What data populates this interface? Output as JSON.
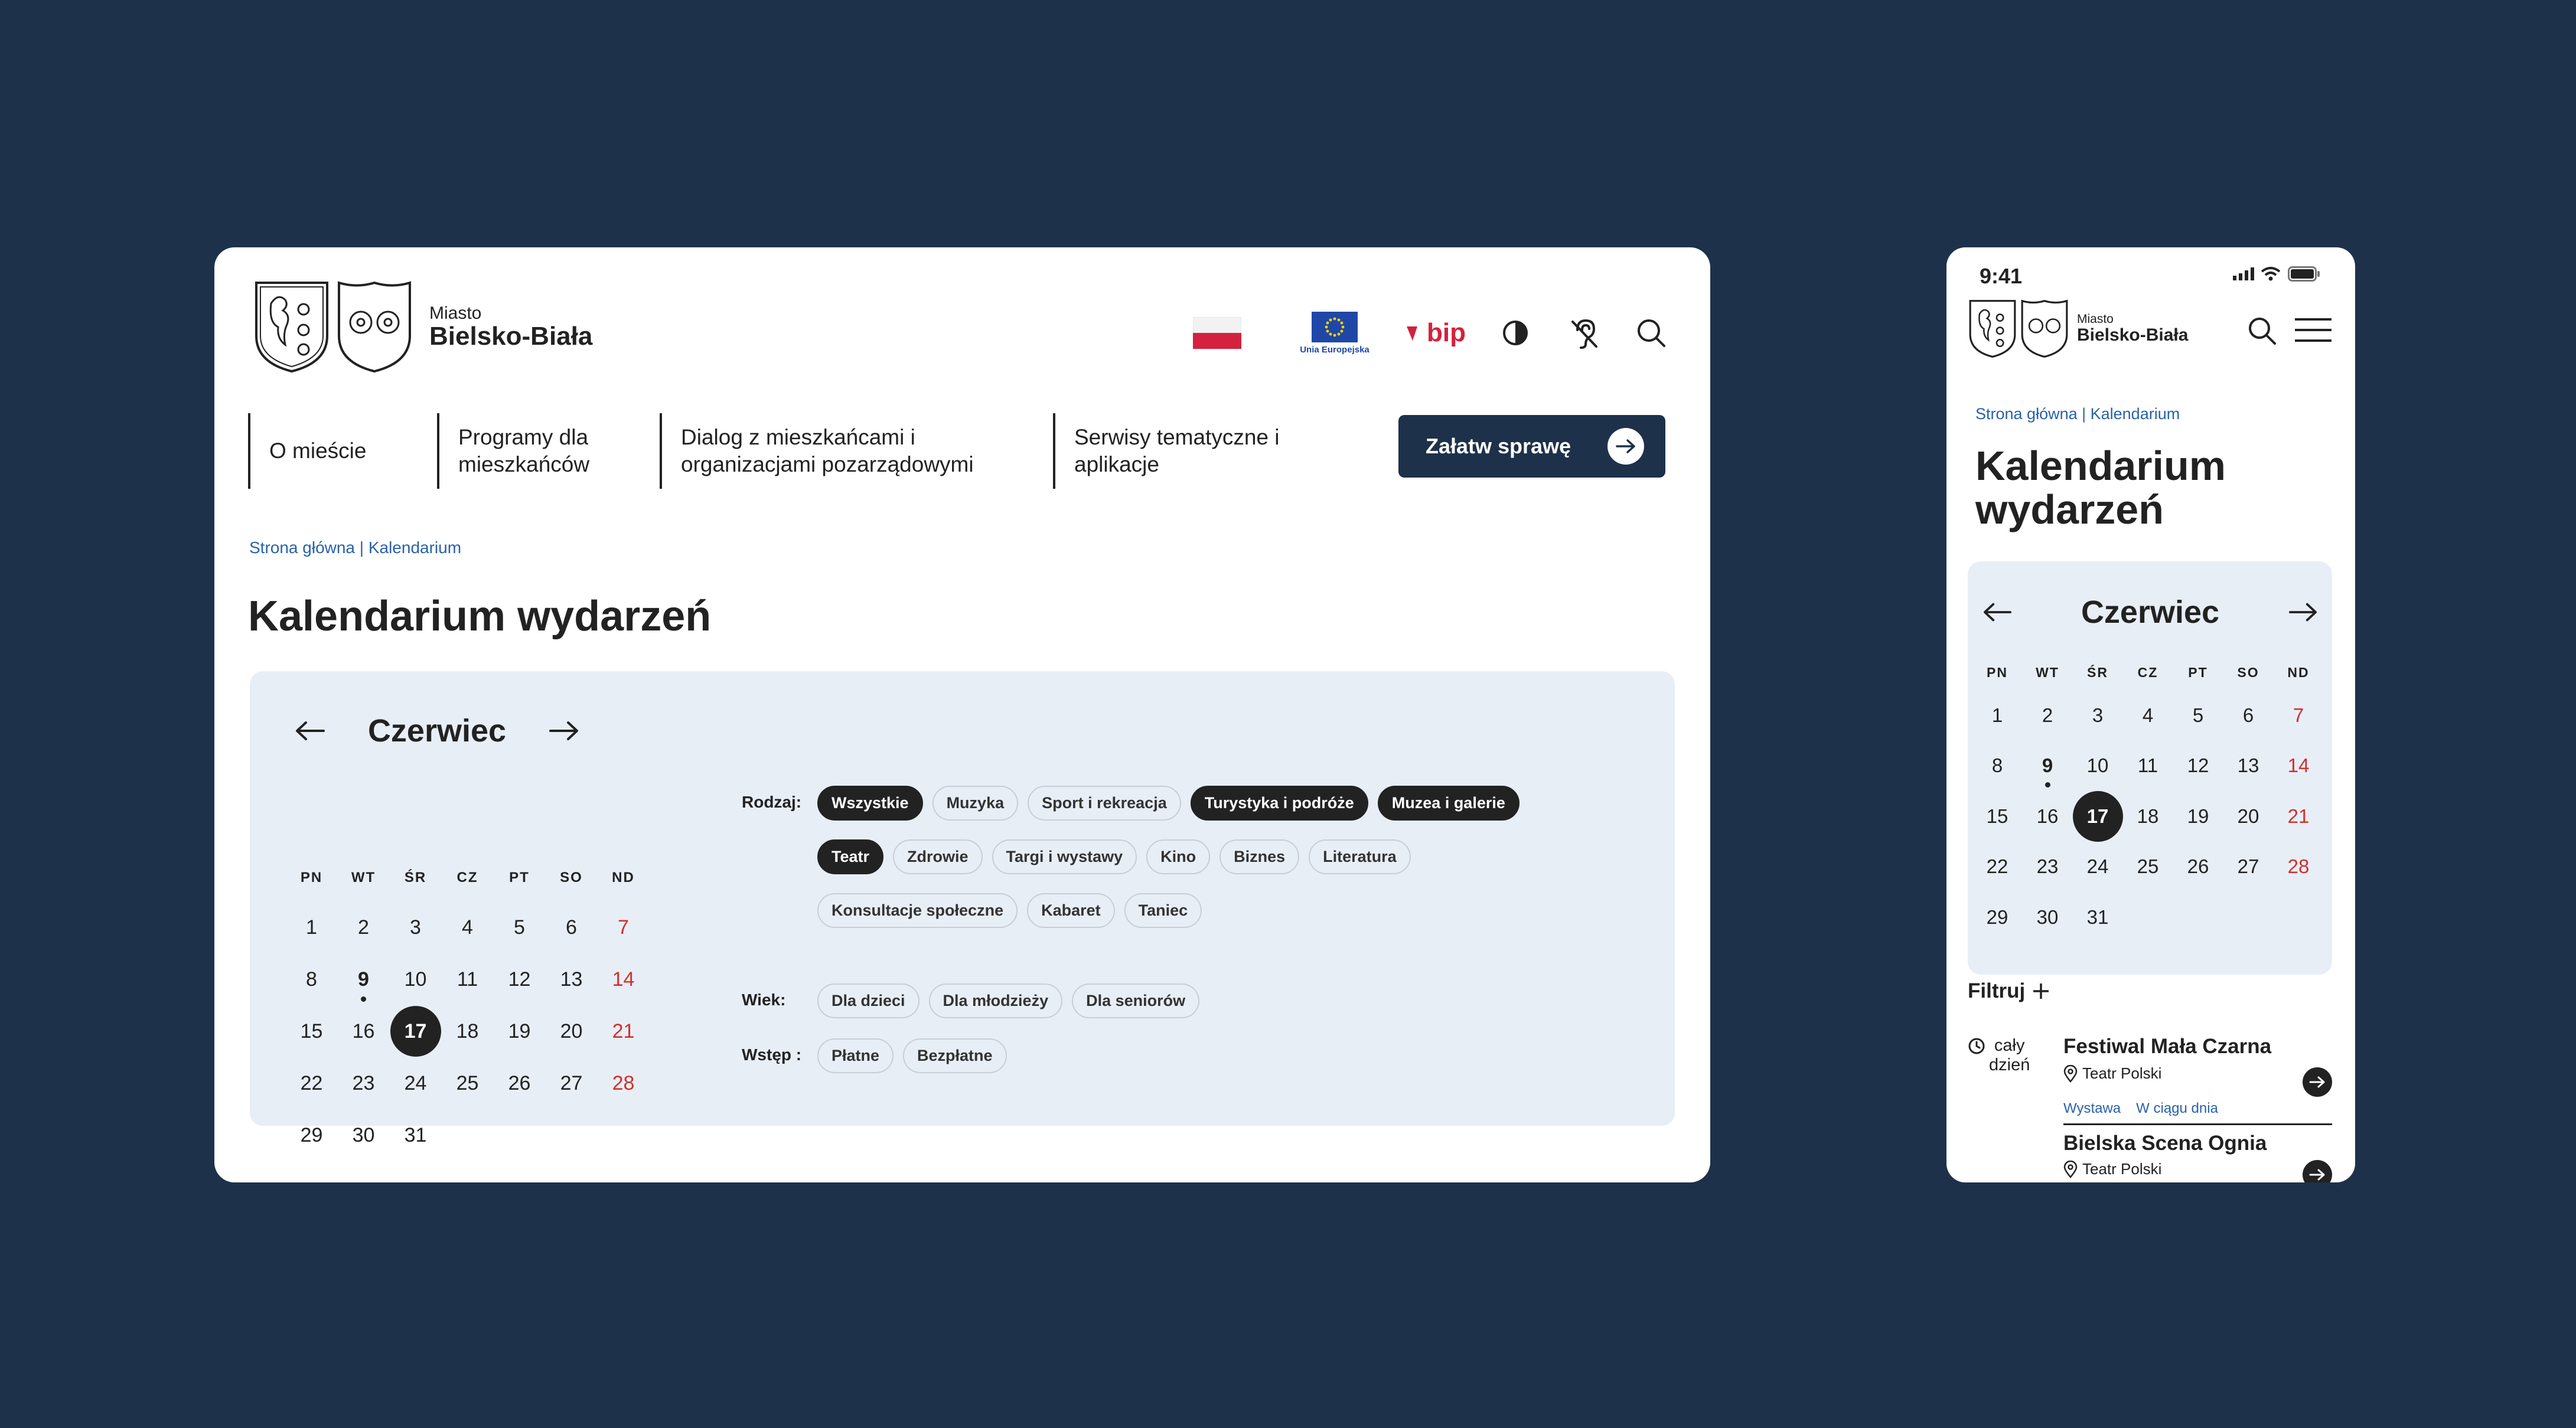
{
  "desktop": {
    "logo": {
      "small": "Miasto",
      "big": "Bielsko-Biała"
    },
    "top_icons": {
      "eu_caption": "Unia Europejska",
      "bip_label": "bip",
      "icons": [
        "polish-flag-icon",
        "eu-flag-icon",
        "bip-icon",
        "contrast-icon",
        "hearing-icon",
        "search-icon"
      ]
    },
    "nav": [
      {
        "label": "O mieście"
      },
      {
        "label": "Programy dla mieszkańców"
      },
      {
        "label": "Dialog z mieszkańcami i organizacjami pozarządowymi"
      },
      {
        "label": "Serwisy tematyczne i aplikacje"
      }
    ],
    "cta": "Załatw sprawę",
    "breadcrumb": "Strona główna | Kalendarium",
    "title": "Kalendarium wydarzeń",
    "calendar": {
      "month": "Czerwiec",
      "days_of_week": [
        "PN",
        "WT",
        "ŚR",
        "CZ",
        "PT",
        "SO",
        "ND"
      ],
      "days": [
        "1",
        "2",
        "3",
        "4",
        "5",
        "6",
        "7",
        "8",
        "9",
        "10",
        "11",
        "12",
        "13",
        "14",
        "15",
        "16",
        "17",
        "18",
        "19",
        "20",
        "21",
        "22",
        "23",
        "24",
        "25",
        "26",
        "27",
        "28",
        "29",
        "30",
        "31"
      ],
      "selected_day": "17",
      "event_day": "9"
    },
    "filters": {
      "type_label": "Rodzaj:",
      "type_chips": [
        {
          "label": "Wszystkie",
          "active": true
        },
        {
          "label": "Muzyka",
          "active": false
        },
        {
          "label": "Sport i rekreacja",
          "active": false
        },
        {
          "label": "Turystyka i podróże",
          "active": true
        },
        {
          "label": "Muzea i galerie",
          "active": true
        },
        {
          "label": "Teatr",
          "active": true
        },
        {
          "label": "Zdrowie",
          "active": false
        },
        {
          "label": "Targi i wystawy",
          "active": false
        },
        {
          "label": "Kino",
          "active": false
        },
        {
          "label": "Biznes",
          "active": false
        },
        {
          "label": "Literatura",
          "active": false
        },
        {
          "label": "Konsultacje społeczne",
          "active": false
        },
        {
          "label": "Kabaret",
          "active": false
        },
        {
          "label": "Taniec",
          "active": false
        }
      ],
      "age_label": "Wiek:",
      "age_chips": [
        "Dla dzieci",
        "Dla młodzieży",
        "Dla seniorów"
      ],
      "entry_label": "Wstęp :",
      "entry_chips": [
        "Płatne",
        "Bezpłatne"
      ]
    }
  },
  "mobile": {
    "status_time": "9:41",
    "logo": {
      "small": "Miasto",
      "big": "Bielsko-Biała"
    },
    "breadcrumb": "Strona główna | Kalendarium",
    "title_line1": "Kalendarium",
    "title_line2": "wydarzeń",
    "calendar_month": "Czerwiec",
    "filter_label": "Filtruj",
    "all_day_line1": "cały",
    "all_day_line2": "dzień",
    "events": [
      {
        "title": "Festiwal Mała Czarna",
        "place": "Teatr Polski",
        "tags": [
          "Wystawa",
          "W ciągu dnia"
        ]
      },
      {
        "title": "Bielska Scena Ognia",
        "place": "Teatr Polski",
        "tags": []
      }
    ]
  },
  "colors": {
    "background": "#1e314a",
    "accent_dark": "#222222",
    "link": "#2a62a8",
    "sunday": "#d0312d",
    "panel": "#e8eef6"
  }
}
